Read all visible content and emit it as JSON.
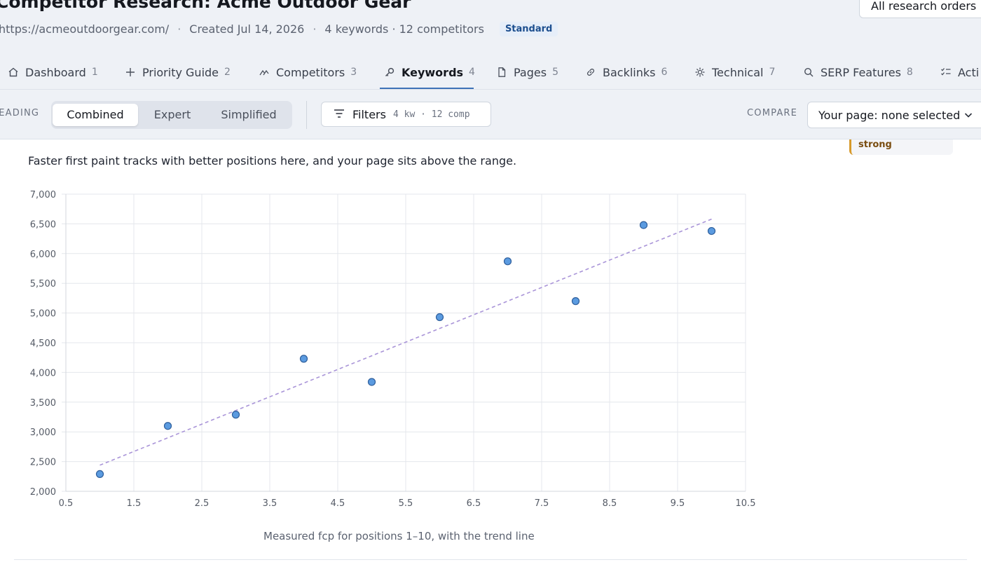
{
  "page": {
    "title": "Competitor Research: Acme Outdoor Gear",
    "url": "https://acmeoutdoorgear.com/",
    "created": "Created Jul 14, 2026",
    "counts": "4 keywords · 12 competitors",
    "tier_badge": "Standard",
    "all_orders_button": "All research orders"
  },
  "tabs": [
    {
      "label": "Dashboard",
      "num": "1",
      "icon": "home-icon"
    },
    {
      "label": "Priority Guide",
      "num": "2",
      "icon": "plus-icon"
    },
    {
      "label": "Competitors",
      "num": "3",
      "icon": "competitors-icon"
    },
    {
      "label": "Keywords",
      "num": "4",
      "icon": "key-icon",
      "active": true
    },
    {
      "label": "Pages",
      "num": "5",
      "icon": "page-icon"
    },
    {
      "label": "Backlinks",
      "num": "6",
      "icon": "link-icon"
    },
    {
      "label": "Technical",
      "num": "7",
      "icon": "gear-icon"
    },
    {
      "label": "SERP Features",
      "num": "8",
      "icon": "search-icon"
    },
    {
      "label": "Acti",
      "num": "",
      "icon": "checklist-icon"
    }
  ],
  "controls": {
    "reading_label": "READING",
    "reading_modes": [
      "Combined",
      "Expert",
      "Simplified"
    ],
    "reading_active": "Combined",
    "filters_label": "Filters",
    "filters_summary": "4 kw · 12 comp",
    "compare_label": "COMPARE",
    "compare_value": "Your page: none selected"
  },
  "content": {
    "strength_chip": "strong",
    "summary": "Faster first paint tracks with better positions here, and your page sits above the range.",
    "caption": "Measured fcp for positions 1–10, with the trend line"
  },
  "colors": {
    "point_fill": "#5b9be0",
    "point_stroke": "#2f5f9c",
    "trend": "#a994d8",
    "active_tab_underline": "#3e72b8"
  },
  "chart_data": {
    "type": "scatter",
    "x": [
      1,
      2,
      3,
      4,
      5,
      6,
      7,
      8,
      9,
      10
    ],
    "y": [
      2290,
      3100,
      3290,
      4230,
      3840,
      4930,
      5870,
      5200,
      6480,
      6380
    ],
    "trend": {
      "x": [
        1,
        10
      ],
      "y": [
        2440,
        6580
      ]
    },
    "xlim": [
      0.5,
      10.5
    ],
    "ylim": [
      2000,
      7000
    ],
    "xticks": [
      "0.5",
      "1.5",
      "2.5",
      "3.5",
      "4.5",
      "5.5",
      "6.5",
      "7.5",
      "8.5",
      "9.5",
      "10.5"
    ],
    "yticks": [
      "2,000",
      "2,500",
      "3,000",
      "3,500",
      "4,000",
      "4,500",
      "5,000",
      "5,500",
      "6,000",
      "6,500",
      "7,000"
    ],
    "grid": true,
    "legend": "none"
  }
}
